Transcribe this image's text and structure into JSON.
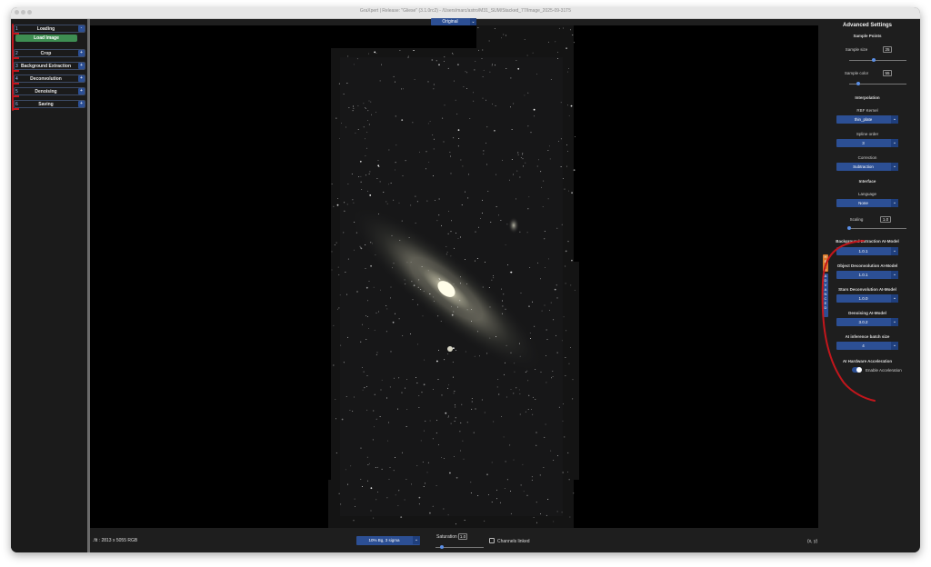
{
  "window": {
    "title": "GraXpert | Release: \"Gliese\" (3.1.0rc2) - /Users/marc/astro/M31_SUM/Stacked_77/Image_2025-09-31T5"
  },
  "view": {
    "selected": "Original"
  },
  "left_panel": {
    "sections": [
      {
        "num": "1",
        "label": "Loading",
        "btn": "-"
      },
      {
        "num": "2",
        "label": "Crop",
        "btn": "+"
      },
      {
        "num": "3",
        "label": "Background Extraction",
        "btn": "+"
      },
      {
        "num": "4",
        "label": "Deconvolution",
        "btn": "+"
      },
      {
        "num": "5",
        "label": "Denoising",
        "btn": "+"
      },
      {
        "num": "6",
        "label": "Saving",
        "btn": "+"
      }
    ],
    "load_button": "Load Image"
  },
  "right_panel": {
    "title": "Advanced Settings",
    "sample_points": "Sample Points",
    "sample_size_label": "Sample size",
    "sample_size_value": "25",
    "sample_color_label": "Sample color",
    "sample_color_value": "55",
    "interpolation": "Interpolation",
    "rbf_kernel_label": "RBF Kernel",
    "rbf_kernel_value": "thin_plate",
    "spline_order_label": "Spline order",
    "spline_order_value": "3",
    "correction_label": "Correction",
    "correction_value": "Subtraction",
    "interface": "Interface",
    "language_label": "Language",
    "language_value": "None",
    "scaling_label": "Scaling",
    "scaling_value": "1.0",
    "bg_model_label": "Background Extraction AI-Model",
    "bg_model_value": "1.0.1",
    "obj_decon_label": "Object Deconvolution AI-Model",
    "obj_decon_value": "1.0.1",
    "stars_decon_label": "Stars Deconvolution AI-Model",
    "stars_decon_value": "1.0.0",
    "denoise_label": "Denoising AI-Model",
    "denoise_value": "3.0.2",
    "batch_label": "AI inference batch size",
    "batch_value": "4",
    "hw_label": "AI Hardware Acceleration",
    "hw_toggle_label": "Enable Acceleration",
    "vtab_help": "HELP",
    "vtab_advanced": "ADVANCED"
  },
  "bottom_bar": {
    "image_info": ".fit : 2813 x 5055 RGB",
    "stretch_value": "10% Bg, 3 sigma",
    "saturation_label": "Saturation",
    "saturation_value": "1.0",
    "channels_label": "Channels linked",
    "coords": "(x, y)"
  },
  "colors": {
    "accent": "#2c4f94",
    "load_button": "#3e8e52",
    "annotation": "#c3161c",
    "help_tab": "#d97a2b"
  }
}
